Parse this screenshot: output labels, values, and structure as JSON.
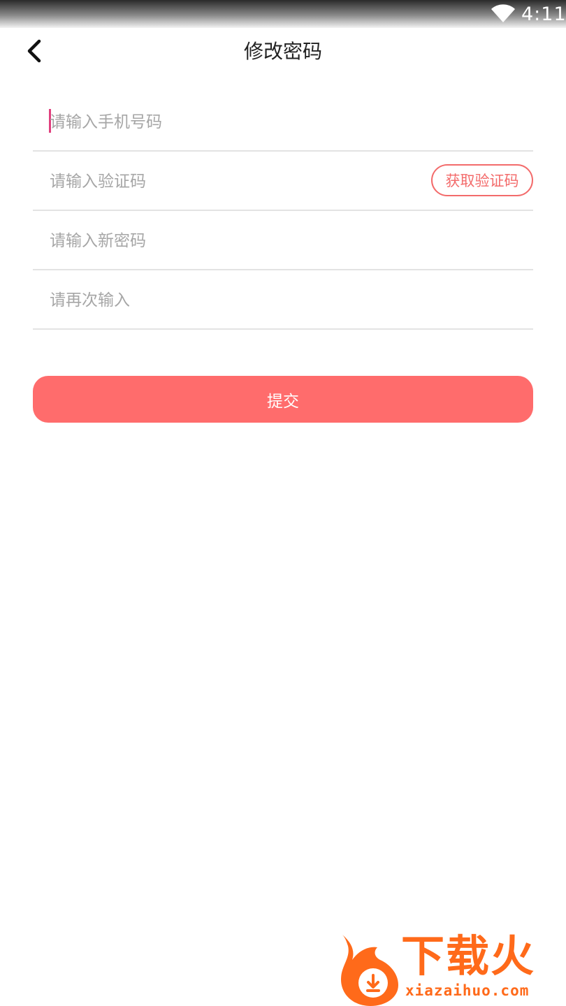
{
  "status_bar": {
    "time": "4:11",
    "icons": [
      "wifi-icon"
    ]
  },
  "header": {
    "back_icon": "chevron-left-icon",
    "title": "修改密码"
  },
  "form": {
    "phone_placeholder": "请输入手机号码",
    "code_placeholder": "请输入验证码",
    "get_code_label": "获取验证码",
    "new_password_placeholder": "请输入新密码",
    "confirm_password_placeholder": "请再次输入"
  },
  "submit_label": "提交",
  "watermark": {
    "title": "下载火",
    "url": "xiazaihuo.com"
  },
  "colors": {
    "accent": "#ff6c6c",
    "accent_border": "#f36b6b",
    "cursor": "#e0407e",
    "placeholder": "#a6a6a6",
    "divider": "#e3e3e3",
    "watermark": "#ff6a1a"
  }
}
